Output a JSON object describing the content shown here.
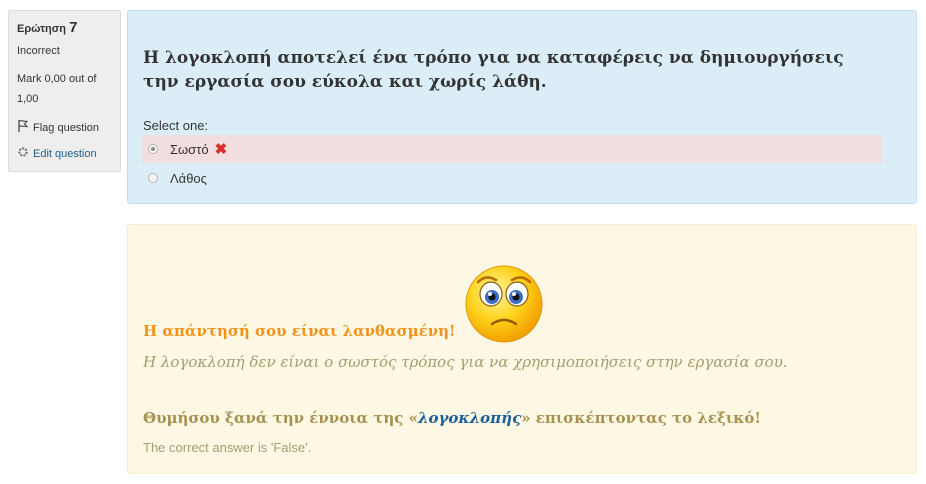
{
  "info": {
    "question_label": "Ερώτηση",
    "question_number": "7",
    "state": "Incorrect",
    "grade": "Mark 0,00 out of 1,00",
    "flag_label": "Flag question",
    "edit_label": "Edit question"
  },
  "question": {
    "text": "Η λογοκλοπή αποτελεί ένα τρόπο για να καταφέρεις να δημιουργήσεις την εργασία σου εύκολα και χωρίς λάθη.",
    "prompt": "Select one:",
    "options": [
      {
        "label": "Σωστό",
        "selected": true,
        "marked_incorrect": true
      },
      {
        "label": "Λάθος",
        "selected": false,
        "marked_incorrect": false
      }
    ]
  },
  "feedback": {
    "heading": "Η απάντησή σου είναι λανθασμένη!",
    "explanation": "Η λογοκλοπή δεν είναι ο σωστός τρόπος για να χρησιμοποιήσεις στην εργασία σου.",
    "reminder_before": "Θυμήσου ξανά την έννοια της «",
    "reminder_link": "λογοκλοπής",
    "reminder_after": "» επισκέπτοντας το λεξικό!",
    "correct_answer": "The correct answer is 'False'."
  },
  "colors": {
    "formulation_bg": "#dbeef8",
    "incorrect_bg": "#f2dede",
    "feedback_bg": "#fcf8e3",
    "heading_orange": "#f0931b",
    "link_blue": "#1a5f95"
  }
}
